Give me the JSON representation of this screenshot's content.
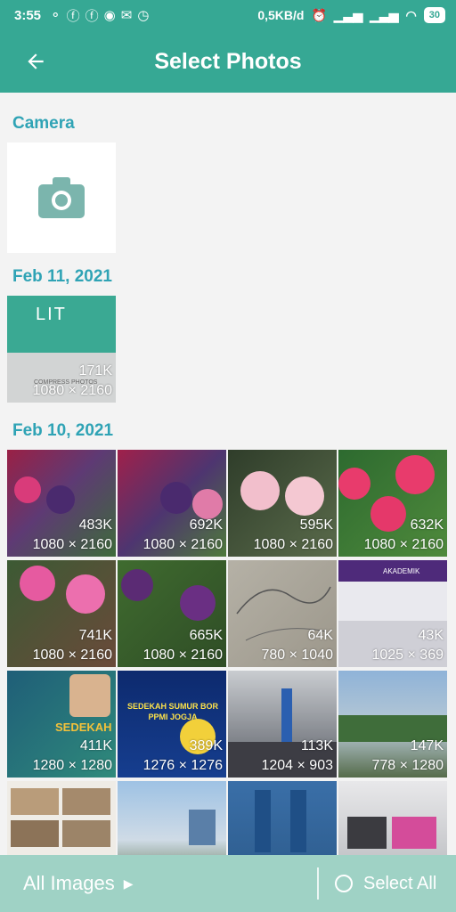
{
  "status": {
    "time": "3:55",
    "network": "0,5KB/d",
    "battery": "30"
  },
  "header": {
    "title": "Select Photos"
  },
  "sections": {
    "camera": "Camera",
    "feb11": "Feb 11, 2021",
    "feb10": "Feb 10, 2021"
  },
  "photos": [
    {
      "size": "171K",
      "dims": "1080 × 2160",
      "label": "COMPRESS PHOTOS",
      "brand": "LIT"
    },
    {
      "size": "483K",
      "dims": "1080 × 2160"
    },
    {
      "size": "692K",
      "dims": "1080 × 2160"
    },
    {
      "size": "595K",
      "dims": "1080 × 2160"
    },
    {
      "size": "632K",
      "dims": "1080 × 2160"
    },
    {
      "size": "741K",
      "dims": "1080 × 2160"
    },
    {
      "size": "665K",
      "dims": "1080 × 2160"
    },
    {
      "size": "64K",
      "dims": "780 × 1040"
    },
    {
      "size": "43K",
      "dims": "1025 × 369",
      "label": "AKADEMIK"
    },
    {
      "size": "411K",
      "dims": "1280 × 1280",
      "label": "SEDEKAH"
    },
    {
      "size": "389K",
      "dims": "1276 × 1276",
      "label": "SEDEKAH SUMUR BOR PPMI JOGJA"
    },
    {
      "size": "113K",
      "dims": "1204 × 903"
    },
    {
      "size": "147K",
      "dims": "778 × 1280"
    }
  ],
  "bottom": {
    "all_images": "All Images",
    "select_all": "Select All"
  },
  "colors": {
    "accent": "#36a894",
    "section": "#2fa3b5",
    "bottom_bar": "#9fd2c5"
  }
}
